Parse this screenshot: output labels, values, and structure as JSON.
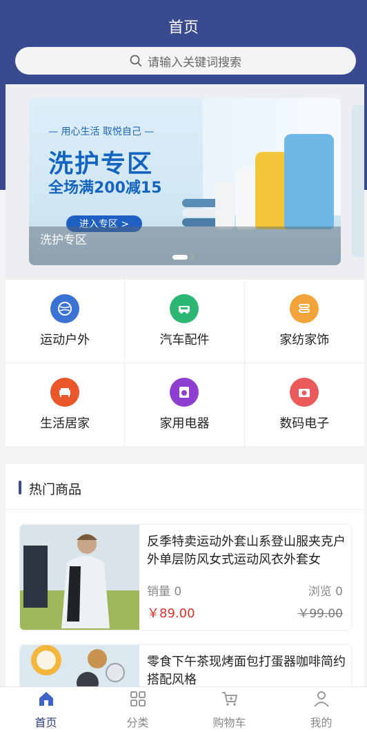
{
  "header": {
    "title": "首页",
    "search_placeholder": "请输入关键词搜索",
    "background_color": "#3a4a8f"
  },
  "banner": {
    "slogan": "— 用心生活 取悦自己 —",
    "headline": "洗护专区",
    "promo": "全场满200减15",
    "cta": "进入专区 >",
    "caption": "洗护专区",
    "active_slide": 1,
    "slide_count": 2
  },
  "categories": [
    {
      "label": "运动户外",
      "icon": "sports-ball-icon",
      "color": "#3b73d4"
    },
    {
      "label": "汽车配件",
      "icon": "car-icon",
      "color": "#2bb673"
    },
    {
      "label": "家纺家饰",
      "icon": "fabric-icon",
      "color": "#f2a33a"
    },
    {
      "label": "生活居家",
      "icon": "sofa-icon",
      "color": "#e8562a"
    },
    {
      "label": "家用电器",
      "icon": "washing-machine-icon",
      "color": "#8e3fd0"
    },
    {
      "label": "数码电子",
      "icon": "camera-icon",
      "color": "#ea5a5a"
    }
  ],
  "hot": {
    "title": "热门商品"
  },
  "products": [
    {
      "name": "反季特卖运动外套山系登山服夹克户外单层防风女式运动风衣外套女",
      "sales_label": "销量 0",
      "views_label": "浏览 0",
      "price": "￥89.00",
      "original_price": "￥99.00"
    },
    {
      "name": "零食下午茶现烤面包打蛋器咖啡简约搭配风格"
    }
  ],
  "tabbar": {
    "items": [
      {
        "label": "首页",
        "icon": "home-icon",
        "active": true
      },
      {
        "label": "分类",
        "icon": "grid-icon",
        "active": false
      },
      {
        "label": "购物车",
        "icon": "cart-icon",
        "active": false
      },
      {
        "label": "我的",
        "icon": "user-icon",
        "active": false
      }
    ]
  },
  "colors": {
    "accent": "#3a4a8f",
    "price": "#d9312a"
  }
}
